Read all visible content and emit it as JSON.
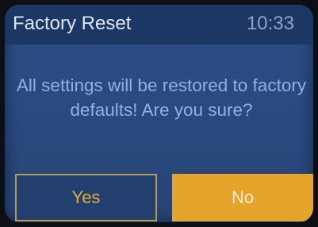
{
  "header": {
    "title": "Factory Reset",
    "time": "10:33"
  },
  "dialog": {
    "message": "All settings will be restored to factory defaults! Are you sure?"
  },
  "buttons": {
    "yes_label": "Yes",
    "no_label": "No"
  },
  "colors": {
    "screen_background": "#2a4a80",
    "title_bar": "#1d3764",
    "message_text": "#8fb0e6",
    "yes_text": "#e3ad3f",
    "no_button_fill": "#e5a42a"
  }
}
